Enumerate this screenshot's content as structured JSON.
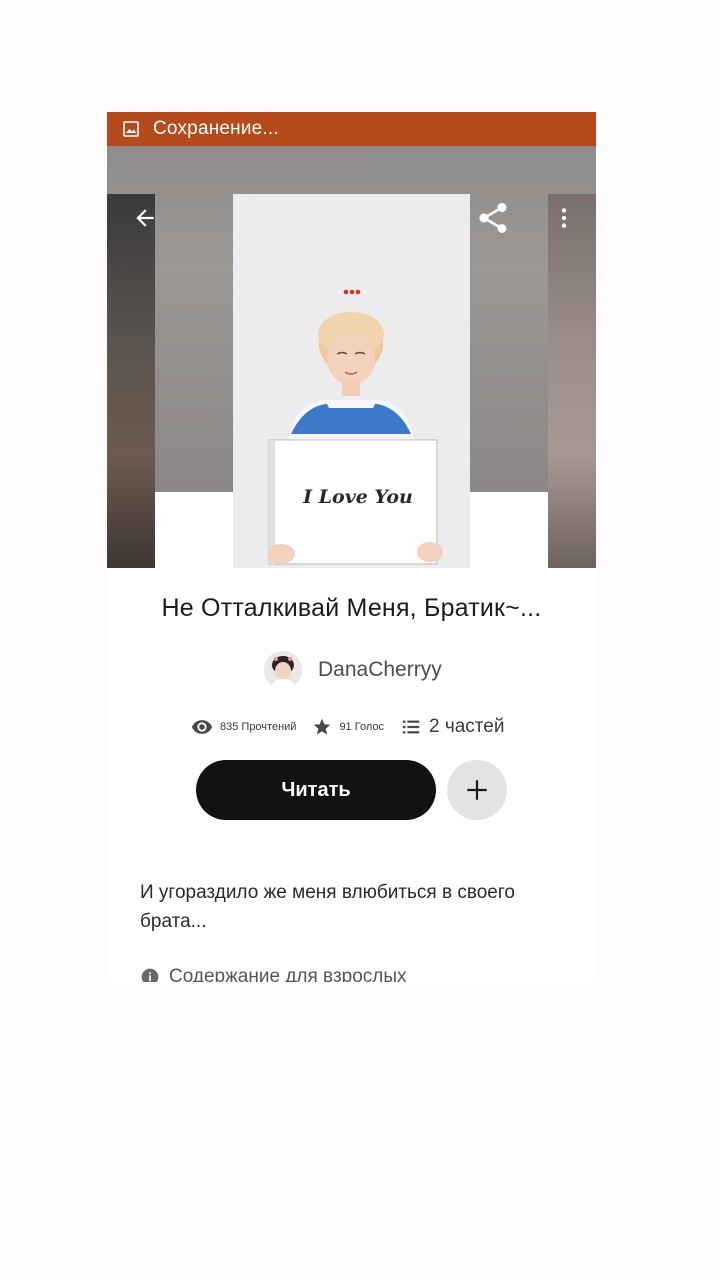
{
  "status_bar": {
    "text": "Сохранение...",
    "color": "#b54a1c"
  },
  "cover": {
    "caption": "I Love You"
  },
  "story": {
    "title": "Не Отталкивай Меня, Братик~...",
    "author": "DanaCherryy"
  },
  "stats": {
    "reads": "835 Прочтений",
    "votes": "91 Голос",
    "parts": "2 частей"
  },
  "actions": {
    "read_label": "Читать"
  },
  "description": "И угораздило же меня влюбиться в своего брата...",
  "mature_label": "Содержание для взрослых",
  "icons": {
    "status": "image-icon",
    "back": "arrow-left-icon",
    "share": "share-icon",
    "more": "more-vertical-icon",
    "reads": "eye-icon",
    "votes": "star-icon",
    "parts": "list-icon",
    "add": "plus-icon",
    "info": "info-icon"
  }
}
